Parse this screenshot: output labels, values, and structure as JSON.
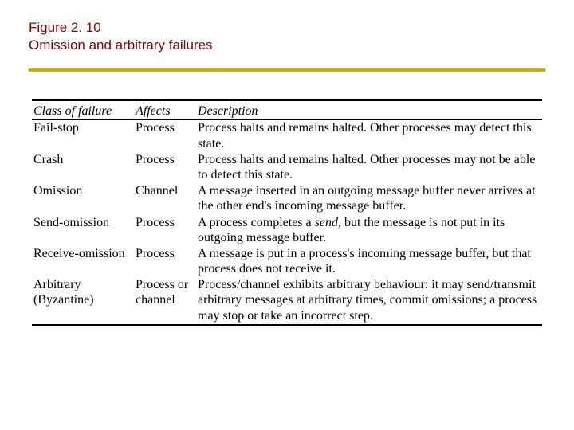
{
  "figure": {
    "number": "Figure 2. 10",
    "title": "Omission and arbitrary failures"
  },
  "table": {
    "headers": {
      "class": "Class of failure",
      "affects": "Affects",
      "description": "Description"
    },
    "rows": [
      {
        "class": "Fail-stop",
        "affects": "Process",
        "description": "Process halts and remains halted. Other processes may detect this state."
      },
      {
        "class": "Crash",
        "affects": "Process",
        "description": "Process halts and remains halted. Other processes may not be able to detect this state."
      },
      {
        "class": "Omission",
        "affects": "Channel",
        "description": "A message inserted in an outgoing message buffer never arrives at the other end's incoming message buffer."
      },
      {
        "class": "Send-omission",
        "affects": "Process",
        "description_pre": "A process completes a ",
        "description_italic": "send,",
        "description_post": " but the message is not put in its outgoing message buffer."
      },
      {
        "class": "Receive-omission",
        "affects": "Process",
        "description": "A message is put in a process's incoming message buffer, but that process does not receive it."
      },
      {
        "class": "Arbitrary (Byzantine)",
        "affects": "Process or channel",
        "description": "Process/channel exhibits arbitrary behaviour: it may send/transmit arbitrary messages at arbitrary times, commit omissions; a process may stop or take an incorrect step."
      }
    ]
  }
}
